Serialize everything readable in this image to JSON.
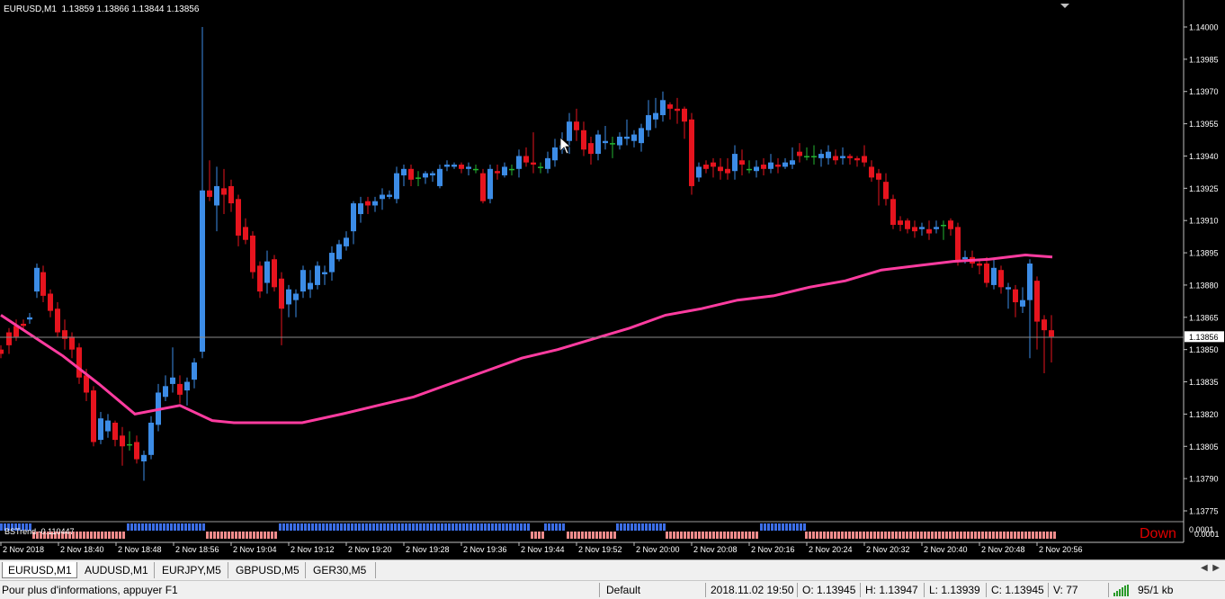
{
  "chart_header": {
    "symbol_tf": "EURUSD,M1",
    "ohlc": "1.13859 1.13866 1.13844 1.13856"
  },
  "price_axis": {
    "ticks": [
      "1.14000",
      "1.13985",
      "1.13970",
      "1.13955",
      "1.13940",
      "1.13925",
      "1.13910",
      "1.13895",
      "1.13880",
      "1.13865",
      "1.13850",
      "1.13835",
      "1.13820",
      "1.13805",
      "1.13790",
      "1.13775"
    ],
    "current_price": "1.13856",
    "indicator_ticks": [
      "0.0001",
      "0.0001"
    ]
  },
  "time_axis": {
    "ticks": [
      "2 Nov 2018",
      "2 Nov 18:40",
      "2 Nov 18:48",
      "2 Nov 18:56",
      "2 Nov 19:04",
      "2 Nov 19:12",
      "2 Nov 19:20",
      "2 Nov 19:28",
      "2 Nov 19:36",
      "2 Nov 19:44",
      "2 Nov 19:52",
      "2 Nov 20:00",
      "2 Nov 20:08",
      "2 Nov 20:16",
      "2 Nov 20:24",
      "2 Nov 20:32",
      "2 Nov 20:40",
      "2 Nov 20:48",
      "2 Nov 20:56"
    ]
  },
  "indicator": {
    "label": "BSTrend -0.110447",
    "signal": "Down"
  },
  "colors": {
    "background": "#000000",
    "bull": "#3c8ce6",
    "bear": "#e6141e",
    "doji": "#23b432",
    "moving_average": "#ff3ca0",
    "ind_up": "#3c6ee6",
    "ind_down": "#f08c8c"
  },
  "tabs": [
    {
      "label": "EURUSD,M1",
      "active": true
    },
    {
      "label": "AUDUSD,M1",
      "active": false
    },
    {
      "label": "EURJPY,M5",
      "active": false
    },
    {
      "label": "GBPUSD,M5",
      "active": false
    },
    {
      "label": "GER30,M5",
      "active": false
    }
  ],
  "status": {
    "help": "Pour plus d'informations, appuyer F1",
    "profile": "Default",
    "datetime": "2018.11.02 19:50",
    "open": "O: 1.13945",
    "high": "H: 1.13947",
    "low": "L: 1.13939",
    "close": "C: 1.13945",
    "volume": "V: 77",
    "traffic": "95/1 kb"
  },
  "chart_data": {
    "type": "candlestick",
    "symbol": "EURUSD",
    "timeframe": "M1",
    "ylim": [
      1.13772,
      1.14008
    ],
    "ma_points": [
      [
        1,
        1.13866
      ],
      [
        30,
        1.13858
      ],
      [
        70,
        1.13847
      ],
      [
        110,
        1.13834
      ],
      [
        150,
        1.1382
      ],
      [
        200,
        1.13824
      ],
      [
        236,
        1.13817
      ],
      [
        260,
        1.13816
      ],
      [
        300,
        1.13816
      ],
      [
        336,
        1.13816
      ],
      [
        380,
        1.1382
      ],
      [
        420,
        1.13824
      ],
      [
        460,
        1.13828
      ],
      [
        500,
        1.13834
      ],
      [
        540,
        1.1384
      ],
      [
        580,
        1.13846
      ],
      [
        620,
        1.1385
      ],
      [
        660,
        1.13855
      ],
      [
        700,
        1.1386
      ],
      [
        740,
        1.13866
      ],
      [
        780,
        1.13869
      ],
      [
        820,
        1.13873
      ],
      [
        860,
        1.13875
      ],
      [
        900,
        1.13879
      ],
      [
        940,
        1.13882
      ],
      [
        980,
        1.13887
      ],
      [
        1020,
        1.13889
      ],
      [
        1060,
        1.13891
      ],
      [
        1100,
        1.13892
      ],
      [
        1140,
        1.13894
      ],
      [
        1170,
        1.13893
      ]
    ],
    "candles": [
      [
        1,
        1.1385,
        1.13848,
        1.13852,
        1.13846
      ],
      [
        10,
        1.13858,
        1.13852,
        1.1386,
        1.13848
      ],
      [
        18,
        1.13861,
        1.13856,
        1.13864,
        1.13854
      ],
      [
        26,
        1.13862,
        1.13861,
        1.13864,
        1.13859
      ],
      [
        33,
        1.13864,
        1.13865,
        1.13867,
        1.13862
      ],
      [
        41,
        1.13877,
        1.13888,
        1.1389,
        1.13874
      ],
      [
        48,
        1.13886,
        1.13875,
        1.13889,
        1.13872
      ],
      [
        56,
        1.13876,
        1.13868,
        1.13878,
        1.13865
      ],
      [
        64,
        1.13869,
        1.13858,
        1.13872,
        1.13856
      ],
      [
        72,
        1.13859,
        1.13855,
        1.13864,
        1.1385
      ],
      [
        80,
        1.13856,
        1.1385,
        1.13858,
        1.13846
      ],
      [
        88,
        1.13851,
        1.13837,
        1.13853,
        1.13834
      ],
      [
        96,
        1.13838,
        1.1383,
        1.13841,
        1.13826
      ],
      [
        104,
        1.13831,
        1.13807,
        1.13833,
        1.13805
      ],
      [
        112,
        1.13808,
        1.13818,
        1.13821,
        1.13806
      ],
      [
        120,
        1.13812,
        1.13817,
        1.1382,
        1.13809
      ],
      [
        128,
        1.13816,
        1.13808,
        1.13817,
        1.13805
      ],
      [
        136,
        1.1381,
        1.13805,
        1.13814,
        1.13796
      ],
      [
        144,
        1.13806,
        1.13806,
        1.13812,
        1.13803
      ],
      [
        152,
        1.13807,
        1.13799,
        1.1381,
        1.13797
      ],
      [
        160,
        1.13798,
        1.13801,
        1.13803,
        1.13789
      ],
      [
        168,
        1.13801,
        1.13816,
        1.13819,
        1.13799
      ],
      [
        176,
        1.13815,
        1.1383,
        1.13834,
        1.13812
      ],
      [
        184,
        1.13828,
        1.13833,
        1.13838,
        1.13826
      ],
      [
        192,
        1.13834,
        1.13837,
        1.13851,
        1.1383
      ],
      [
        200,
        1.13834,
        1.13829,
        1.13838,
        1.13825
      ],
      [
        208,
        1.13831,
        1.13835,
        1.13837,
        1.13824
      ],
      [
        216,
        1.13836,
        1.13844,
        1.13846,
        1.13832
      ],
      [
        225,
        1.13849,
        1.13924,
        1.14,
        1.13846
      ],
      [
        233,
        1.13924,
        1.13921,
        1.13938,
        1.13919
      ],
      [
        241,
        1.13917,
        1.13926,
        1.13935,
        1.13905
      ],
      [
        249,
        1.13925,
        1.13922,
        1.13934,
        1.13913
      ],
      [
        257,
        1.13926,
        1.13918,
        1.13929,
        1.13914
      ],
      [
        265,
        1.1392,
        1.13903,
        1.13922,
        1.13898
      ],
      [
        273,
        1.13907,
        1.13901,
        1.13911,
        1.13899
      ],
      [
        281,
        1.13903,
        1.13886,
        1.13905,
        1.13883
      ],
      [
        289,
        1.13889,
        1.13877,
        1.13891,
        1.13874
      ],
      [
        297,
        1.13881,
        1.13891,
        1.13896,
        1.13876
      ],
      [
        305,
        1.13892,
        1.13879,
        1.13894,
        1.13877
      ],
      [
        313,
        1.13883,
        1.13869,
        1.13886,
        1.13852
      ],
      [
        321,
        1.13871,
        1.13878,
        1.1388,
        1.13865
      ],
      [
        329,
        1.13873,
        1.13876,
        1.13878,
        1.13865
      ],
      [
        337,
        1.13877,
        1.13887,
        1.13889,
        1.13874
      ],
      [
        345,
        1.13878,
        1.13881,
        1.13887,
        1.13874
      ],
      [
        353,
        1.1388,
        1.13889,
        1.13891,
        1.13878
      ],
      [
        361,
        1.13885,
        1.13886,
        1.13889,
        1.1388
      ],
      [
        369,
        1.13886,
        1.13895,
        1.13898,
        1.13882
      ],
      [
        377,
        1.13892,
        1.13899,
        1.13901,
        1.13891
      ],
      [
        385,
        1.13898,
        1.13902,
        1.13905,
        1.13896
      ],
      [
        393,
        1.13905,
        1.13918,
        1.13919,
        1.13899
      ],
      [
        401,
        1.13913,
        1.13918,
        1.13921,
        1.13909
      ],
      [
        409,
        1.13919,
        1.13917,
        1.13921,
        1.13913
      ],
      [
        417,
        1.13917,
        1.13919,
        1.13921,
        1.13914
      ],
      [
        425,
        1.1392,
        1.13922,
        1.13925,
        1.13915
      ],
      [
        433,
        1.13921,
        1.13922,
        1.13924,
        1.1392
      ],
      [
        441,
        1.1392,
        1.13932,
        1.13935,
        1.13918
      ],
      [
        449,
        1.13931,
        1.13934,
        1.13936,
        1.13926
      ],
      [
        457,
        1.13934,
        1.13929,
        1.13936,
        1.13926
      ],
      [
        465,
        1.1393,
        1.1393,
        1.13933,
        1.13926
      ],
      [
        473,
        1.1393,
        1.13932,
        1.13933,
        1.13927
      ],
      [
        481,
        1.13931,
        1.13932,
        1.13933,
        1.13928
      ],
      [
        489,
        1.13926,
        1.13934,
        1.13936,
        1.13925
      ],
      [
        497,
        1.13935,
        1.13936,
        1.13938,
        1.13933
      ],
      [
        505,
        1.13935,
        1.13936,
        1.13937,
        1.13934
      ],
      [
        513,
        1.13936,
        1.13934,
        1.13937,
        1.13932
      ],
      [
        521,
        1.13934,
        1.13935,
        1.13937,
        1.13931
      ],
      [
        529,
        1.13934,
        1.13934,
        1.13936,
        1.13932
      ],
      [
        537,
        1.13932,
        1.13919,
        1.13934,
        1.13918
      ],
      [
        545,
        1.1392,
        1.13934,
        1.13936,
        1.13918
      ],
      [
        553,
        1.13933,
        1.13932,
        1.13936,
        1.13929
      ],
      [
        561,
        1.13931,
        1.13935,
        1.13937,
        1.1393
      ],
      [
        569,
        1.13934,
        1.13934,
        1.13936,
        1.13931
      ],
      [
        577,
        1.13934,
        1.1394,
        1.13943,
        1.1393
      ],
      [
        585,
        1.1394,
        1.13937,
        1.13944,
        1.13935
      ],
      [
        593,
        1.13937,
        1.13936,
        1.13951,
        1.13932
      ],
      [
        601,
        1.13935,
        1.13935,
        1.13937,
        1.13932
      ],
      [
        609,
        1.13934,
        1.13939,
        1.13942,
        1.13932
      ],
      [
        617,
        1.13938,
        1.13944,
        1.13948,
        1.13935
      ],
      [
        625,
        1.13943,
        1.13945,
        1.13951,
        1.13941
      ],
      [
        633,
        1.13947,
        1.13956,
        1.1396,
        1.13941
      ],
      [
        641,
        1.13956,
        1.13952,
        1.13962,
        1.13947
      ],
      [
        649,
        1.13952,
        1.13943,
        1.13956,
        1.1394
      ],
      [
        657,
        1.13946,
        1.13941,
        1.13949,
        1.13936
      ],
      [
        665,
        1.13941,
        1.1395,
        1.13952,
        1.13938
      ],
      [
        673,
        1.13946,
        1.13947,
        1.13954,
        1.13943
      ],
      [
        681,
        1.13946,
        1.13946,
        1.13949,
        1.13939
      ],
      [
        689,
        1.13945,
        1.13949,
        1.13951,
        1.13943
      ],
      [
        697,
        1.13948,
        1.13949,
        1.13957,
        1.13945
      ],
      [
        705,
        1.13947,
        1.1395,
        1.13952,
        1.13944
      ],
      [
        713,
        1.13946,
        1.13953,
        1.13955,
        1.13942
      ],
      [
        721,
        1.13952,
        1.13959,
        1.13966,
        1.13949
      ],
      [
        729,
        1.13957,
        1.1396,
        1.13967,
        1.13953
      ],
      [
        737,
        1.13959,
        1.13966,
        1.1397,
        1.13956
      ],
      [
        745,
        1.13964,
        1.13962,
        1.13965,
        1.13957
      ],
      [
        753,
        1.13962,
        1.13961,
        1.13967,
        1.13955
      ],
      [
        761,
        1.13962,
        1.13956,
        1.13963,
        1.13948
      ],
      [
        769,
        1.13957,
        1.13926,
        1.1396,
        1.13922
      ],
      [
        777,
        1.1393,
        1.13935,
        1.13937,
        1.13928
      ],
      [
        785,
        1.13936,
        1.13934,
        1.13938,
        1.13932
      ],
      [
        793,
        1.13937,
        1.13935,
        1.13939,
        1.1393
      ],
      [
        801,
        1.13935,
        1.13933,
        1.13939,
        1.13929
      ],
      [
        809,
        1.13934,
        1.13932,
        1.13939,
        1.13929
      ],
      [
        817,
        1.13933,
        1.13941,
        1.13945,
        1.13929
      ],
      [
        825,
        1.13938,
        1.13936,
        1.13943,
        1.13931
      ],
      [
        833,
        1.13934,
        1.13934,
        1.13938,
        1.13932
      ],
      [
        841,
        1.13933,
        1.13935,
        1.13938,
        1.1393
      ],
      [
        849,
        1.13936,
        1.13934,
        1.13939,
        1.13931
      ],
      [
        857,
        1.13934,
        1.13937,
        1.13941,
        1.13932
      ],
      [
        865,
        1.13936,
        1.13935,
        1.13939,
        1.13932
      ],
      [
        873,
        1.13935,
        1.13937,
        1.13939,
        1.13934
      ],
      [
        881,
        1.13936,
        1.13938,
        1.13944,
        1.13934
      ],
      [
        889,
        1.13942,
        1.1394,
        1.13946,
        1.13937
      ],
      [
        897,
        1.1394,
        1.1394,
        1.13944,
        1.13938
      ],
      [
        905,
        1.1394,
        1.1394,
        1.13945,
        1.13936
      ],
      [
        913,
        1.13939,
        1.13941,
        1.13943,
        1.13935
      ],
      [
        921,
        1.13939,
        1.13942,
        1.13945,
        1.13936
      ],
      [
        929,
        1.1394,
        1.13938,
        1.13943,
        1.13936
      ],
      [
        937,
        1.13939,
        1.1394,
        1.13944,
        1.13936
      ],
      [
        945,
        1.1394,
        1.13939,
        1.13941,
        1.13936
      ],
      [
        953,
        1.13939,
        1.13938,
        1.1394,
        1.13935
      ],
      [
        961,
        1.1394,
        1.13937,
        1.13945,
        1.13935
      ],
      [
        969,
        1.13935,
        1.1393,
        1.13938,
        1.13928
      ],
      [
        977,
        1.13932,
        1.13929,
        1.13934,
        1.13917
      ],
      [
        985,
        1.13928,
        1.1392,
        1.13932,
        1.13917
      ],
      [
        993,
        1.1392,
        1.13908,
        1.13922,
        1.13906
      ],
      [
        1001,
        1.1391,
        1.13908,
        1.13912,
        1.13905
      ],
      [
        1009,
        1.1391,
        1.13906,
        1.13911,
        1.13904
      ],
      [
        1017,
        1.13907,
        1.13905,
        1.1391,
        1.13902
      ],
      [
        1025,
        1.13906,
        1.13907,
        1.13909,
        1.13903
      ],
      [
        1033,
        1.13906,
        1.13904,
        1.1391,
        1.13901
      ],
      [
        1041,
        1.13906,
        1.13907,
        1.1391,
        1.13904
      ],
      [
        1049,
        1.13908,
        1.13908,
        1.1391,
        1.13901
      ],
      [
        1057,
        1.1391,
        1.13906,
        1.13911,
        1.13903
      ],
      [
        1065,
        1.13907,
        1.13891,
        1.13909,
        1.13889
      ],
      [
        1073,
        1.13892,
        1.13893,
        1.13896,
        1.1389
      ],
      [
        1081,
        1.13893,
        1.1389,
        1.13896,
        1.13888
      ],
      [
        1089,
        1.1389,
        1.13889,
        1.13892,
        1.13885
      ],
      [
        1097,
        1.1389,
        1.13881,
        1.13893,
        1.13879
      ],
      [
        1105,
        1.1388,
        1.13888,
        1.13892,
        1.13878
      ],
      [
        1113,
        1.13887,
        1.13879,
        1.13889,
        1.13876
      ],
      [
        1121,
        1.13878,
        1.13879,
        1.13881,
        1.13869
      ],
      [
        1129,
        1.13878,
        1.13872,
        1.1388,
        1.13865
      ],
      [
        1137,
        1.1387,
        1.13873,
        1.13879,
        1.13867
      ],
      [
        1145,
        1.13873,
        1.1389,
        1.13892,
        1.13846
      ],
      [
        1153,
        1.13882,
        1.13863,
        1.13884,
        1.1385
      ],
      [
        1161,
        1.13864,
        1.13859,
        1.13866,
        1.13839
      ],
      [
        1169,
        1.13859,
        1.13856,
        1.13866,
        1.13844
      ]
    ],
    "indicator_blocks": [
      [
        0,
        36,
        "up"
      ],
      [
        36,
        141,
        "down"
      ],
      [
        141,
        229,
        "up"
      ],
      [
        229,
        310,
        "down"
      ],
      [
        310,
        590,
        "up"
      ],
      [
        590,
        605,
        "down"
      ],
      [
        605,
        630,
        "up"
      ],
      [
        630,
        685,
        "down"
      ],
      [
        685,
        740,
        "up"
      ],
      [
        740,
        845,
        "down"
      ],
      [
        845,
        895,
        "up"
      ],
      [
        895,
        1176,
        "down"
      ]
    ]
  }
}
